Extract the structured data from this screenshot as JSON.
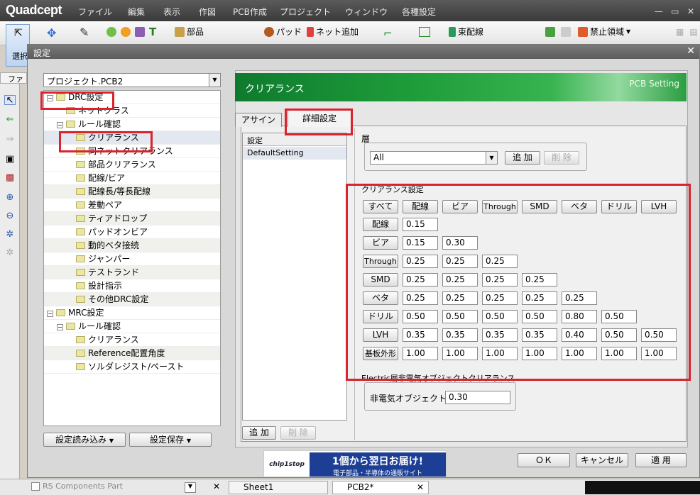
{
  "app": {
    "logo": "Quadcept"
  },
  "menu": [
    "ファイル",
    "編集",
    "表示",
    "作図",
    "PCB作成",
    "プロジェクト",
    "ウィンドウ",
    "各種設定"
  ],
  "toolbar": {
    "select_label": "選択",
    "parts": "部品",
    "pad": "パッド",
    "net_add": "ネット追加",
    "bundle": "束配線",
    "forbidden": "禁止領域",
    "file_tab": "ファ"
  },
  "dialog": {
    "title": "設定",
    "project": "プロジェクト.PCB2",
    "tree": [
      {
        "label": "DRC設定",
        "level": 0,
        "expander": "−"
      },
      {
        "label": "ネットクラス",
        "level": 1
      },
      {
        "label": "ルール確認",
        "level": 1,
        "expander": "−"
      },
      {
        "label": "クリアランス",
        "level": 2,
        "selected": true
      },
      {
        "label": "同ネットクリアランス",
        "level": 2
      },
      {
        "label": "部品クリアランス",
        "level": 2
      },
      {
        "label": "配線/ビア",
        "level": 2
      },
      {
        "label": "配線長/等長配線",
        "level": 2
      },
      {
        "label": "差動ペア",
        "level": 2
      },
      {
        "label": "ティアドロップ",
        "level": 2
      },
      {
        "label": "パッドオンビア",
        "level": 2
      },
      {
        "label": "動的ベタ接続",
        "level": 2
      },
      {
        "label": "ジャンパー",
        "level": 2
      },
      {
        "label": "テストランド",
        "level": 2
      },
      {
        "label": "設計指示",
        "level": 2
      },
      {
        "label": "その他DRC設定",
        "level": 2
      },
      {
        "label": "MRC設定",
        "level": 0,
        "expander": "−"
      },
      {
        "label": "ルール確認",
        "level": 1,
        "expander": "−"
      },
      {
        "label": "クリアランス",
        "level": 2
      },
      {
        "label": "Reference配置角度",
        "level": 2
      },
      {
        "label": "ソルダレジスト/ペースト",
        "level": 2
      }
    ],
    "load_btn": "設定読み込み",
    "save_btn": "設定保存",
    "banner_title": "クリアランス",
    "banner_sub": "PCB Setting",
    "tabs": [
      "アサイン",
      "詳細設定"
    ],
    "list_header": "設定",
    "list_items": [
      "DefaultSetting"
    ],
    "add_btn": "追 加",
    "del_btn": "削 除",
    "layer_label": "層",
    "layer_value": "All",
    "clearance_label": "クリアランス設定",
    "columns": [
      "すべて",
      "配線",
      "ビア",
      "Through",
      "SMD",
      "ベタ",
      "ドリル",
      "LVH"
    ],
    "rows": [
      {
        "label": "配線",
        "values": [
          "0.15"
        ]
      },
      {
        "label": "ビア",
        "values": [
          "0.15",
          "0.30"
        ]
      },
      {
        "label": "Through",
        "values": [
          "0.25",
          "0.25",
          "0.25"
        ]
      },
      {
        "label": "SMD",
        "values": [
          "0.25",
          "0.25",
          "0.25",
          "0.25"
        ]
      },
      {
        "label": "ベタ",
        "values": [
          "0.25",
          "0.25",
          "0.25",
          "0.25",
          "0.25"
        ]
      },
      {
        "label": "ドリル",
        "values": [
          "0.50",
          "0.50",
          "0.50",
          "0.50",
          "0.80",
          "0.50"
        ]
      },
      {
        "label": "LVH",
        "values": [
          "0.35",
          "0.35",
          "0.35",
          "0.35",
          "0.40",
          "0.50",
          "0.50"
        ]
      },
      {
        "label": "基板外形",
        "values": [
          "1.00",
          "1.00",
          "1.00",
          "1.00",
          "1.00",
          "1.00",
          "1.00"
        ]
      }
    ],
    "electric_label": "Electric層非電気オブジェクトクリアランス",
    "non_electric_label": "非電気オブジェクト",
    "non_electric_value": "0.30",
    "ok": "ＯＫ",
    "cancel": "キャンセル",
    "apply": "適 用",
    "ad_logo": "chip1stop",
    "ad_main": "1個から翌日お届け!",
    "ad_sub": "電子部品・半導体の通販サイト"
  },
  "status": {
    "search_placeholder": "RS Components Part",
    "tab1": "Sheet1",
    "tab2": "PCB2*"
  },
  "colors": {
    "highlight": "#d9232e",
    "banner": "#1f9d3a"
  }
}
